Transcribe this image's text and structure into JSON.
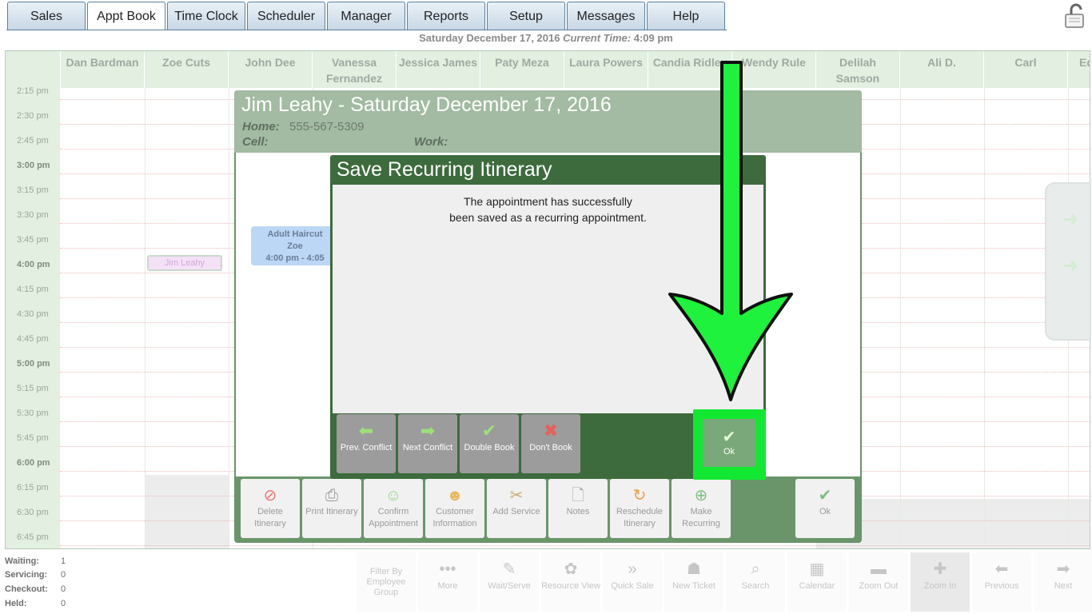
{
  "nav": {
    "tabs": [
      "Sales",
      "Appt Book",
      "Time Clock",
      "Scheduler",
      "Manager",
      "Reports",
      "Setup",
      "Messages",
      "Help"
    ],
    "active_tab": "Appt Book"
  },
  "header": {
    "date": "Saturday December 17, 2016",
    "current_time_label": "Current Time:",
    "current_time": "4:09 pm"
  },
  "calendar": {
    "employees": [
      "Dan Bardman",
      "Zoe Cuts",
      "John Dee",
      "Vanessa Fernandez",
      "Jessica James",
      "Paty Meza",
      "Laura Powers",
      "Candia Ridley",
      "Wendy Rule",
      "Delilah Samson",
      "Ali D.",
      "Carl",
      "Ed"
    ],
    "times": [
      "2:15 pm",
      "2:30 pm",
      "2:45 pm",
      "3:00 pm",
      "3:15 pm",
      "3:30 pm",
      "3:45 pm",
      "4:00 pm",
      "4:15 pm",
      "4:30 pm",
      "4:45 pm",
      "5:00 pm",
      "5:15 pm",
      "5:30 pm",
      "5:45 pm",
      "6:00 pm",
      "6:15 pm",
      "6:30 pm",
      "6:45 pm"
    ],
    "booked_block": "Jim Leahy"
  },
  "itinerary": {
    "title": "Jim Leahy - Saturday December 17, 2016",
    "home_label": "Home:",
    "home_value": "555-567-5309",
    "cell_label": "Cell:",
    "work_label": "Work:",
    "appointment": {
      "service": "Adult Haircut",
      "employee": "Zoe",
      "time": "4:00 pm - 4:05"
    },
    "toolbar": [
      {
        "label": "Delete Itinerary",
        "icon": "delete-icon"
      },
      {
        "label": "Print Itinerary",
        "icon": "printer-icon"
      },
      {
        "label": "Confirm Appointment",
        "icon": "smiley-icon"
      },
      {
        "label": "Customer Information",
        "icon": "person-icon"
      },
      {
        "label": "Add Service",
        "icon": "scissors-icon"
      },
      {
        "label": "Notes",
        "icon": "notes-icon"
      },
      {
        "label": "Reschedule Itinerary",
        "icon": "reschedule-icon"
      },
      {
        "label": "Make Recurring",
        "icon": "recurring-icon"
      }
    ],
    "ok_label": "Ok"
  },
  "modal": {
    "title": "Save Recurring Itinerary",
    "message_line1": "The appointment has successfully",
    "message_line2": "been saved as a recurring appointment.",
    "buttons": [
      {
        "label": "Prev. Conflict",
        "icon": "left-arrow-icon"
      },
      {
        "label": "Next Conflict",
        "icon": "right-arrow-icon"
      },
      {
        "label": "Double Book",
        "icon": "check-icon"
      },
      {
        "label": "Don't Book",
        "icon": "x-icon"
      }
    ],
    "ok_label": "Ok",
    "highlight_color": "#12e832"
  },
  "status": {
    "waiting_label": "Waiting:",
    "waiting": "1",
    "servicing_label": "Servicing:",
    "servicing": "0",
    "checkout_label": "Checkout:",
    "checkout": "0",
    "held_label": "Held:",
    "held": "0"
  },
  "bottom_toolbar": [
    {
      "label": "Filter By Employee Group",
      "icon": ""
    },
    {
      "label": "More",
      "icon": "dots-icon"
    },
    {
      "label": "Wait/Serve",
      "icon": "wait-serve-icon"
    },
    {
      "label": "Resource View",
      "icon": "resource-icon"
    },
    {
      "label": "Quick Sale",
      "icon": "quick-sale-icon"
    },
    {
      "label": "New Ticket",
      "icon": "new-ticket-icon"
    },
    {
      "label": "Search",
      "icon": "search-icon"
    },
    {
      "label": "Calendar",
      "icon": "calendar-icon"
    },
    {
      "label": "Zoom Out",
      "icon": "zoom-out-icon"
    },
    {
      "label": "Zoom In",
      "icon": "zoom-in-icon"
    },
    {
      "label": "Previous",
      "icon": "previous-icon"
    },
    {
      "label": "Next",
      "icon": "next-icon"
    }
  ]
}
